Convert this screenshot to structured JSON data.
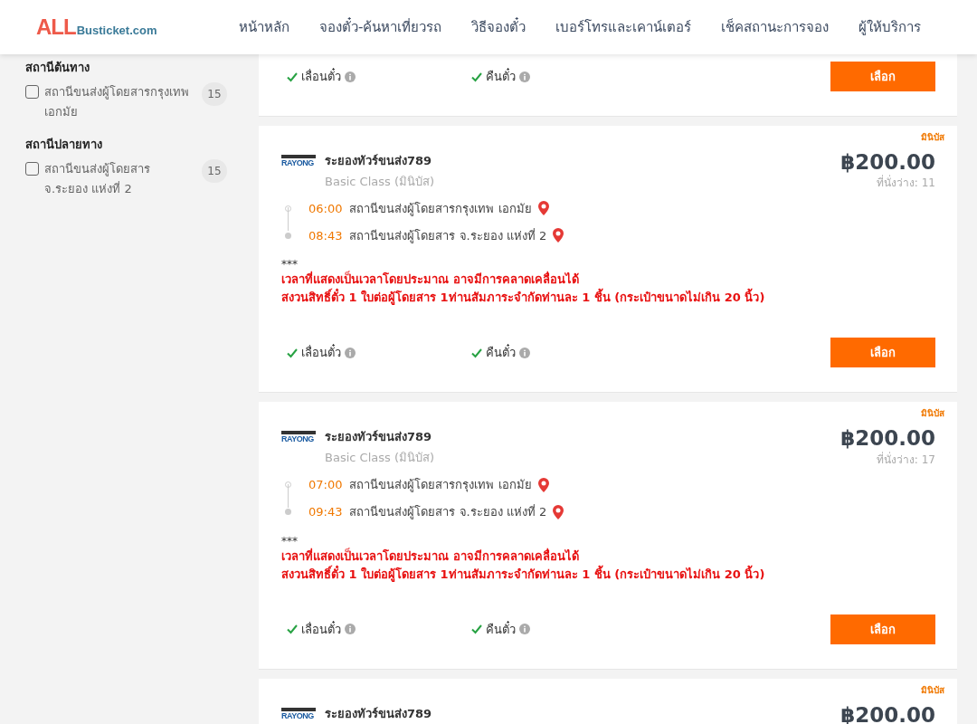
{
  "header": {
    "logo": {
      "accent": "ALL",
      "rest": "Busticket.com"
    },
    "nav": [
      {
        "label": "หน้าหลัก",
        "selected": false
      },
      {
        "label": "จองตั๋ว-ค้นหาเที่ยวรถ",
        "selected": false
      },
      {
        "label": "วิธีจองตั๋ว",
        "selected": false
      },
      {
        "label": "เบอร์โทรและเคาน์เตอร์",
        "selected": false
      },
      {
        "label": "เช็คสถานะการจอง",
        "selected": false
      },
      {
        "label": "ผู้ให้บริการ",
        "selected": false
      }
    ]
  },
  "sidebar": {
    "filters": [
      {
        "title": "สถานีต้นทาง",
        "items": [
          {
            "label": "สถานีขนส่งผู้โดยสารกรุงเทพ เอกมัย",
            "count": "15",
            "checked": false
          }
        ]
      },
      {
        "title": "สถานีปลายทาง",
        "items": [
          {
            "label": "สถานีขนส่งผู้โดยสาร จ.ระยอง แห่งที่ 2",
            "count": "15",
            "checked": false
          }
        ]
      }
    ]
  },
  "trips": [
    {
      "features": [
        {
          "label": "เลื่อนตั๋ว",
          "ok": true
        },
        {
          "label": "คืนตั๋ว",
          "ok": true
        }
      ],
      "button": "เลือก"
    },
    {
      "tag": "มินิบัส",
      "logo_text": "RAYONG",
      "operator": "ระยองทัวร์ขนส่ง789",
      "class": "Basic Class (มินิบัส)",
      "price": "฿200.00",
      "seats": "ที่นั่งว่าง: 11",
      "stops": [
        {
          "time": "06:00",
          "station": "สถานีขนส่งผู้โดยสารกรุงเทพ เอกมัย"
        },
        {
          "time": "08:43",
          "station": "สถานีขนส่งผู้โดยสาร จ.ระยอง แห่งที่ 2"
        }
      ],
      "note": "***",
      "warnings": [
        "เวลาที่แสดงเป็นเวลาโดยประมาณ อาจมีการคลาดเคลื่อนได้",
        "สงวนสิทธิ์ตั๋ว 1 ใบต่อผู้โดยสาร 1ท่านสัมภาระจำกัดท่านละ 1 ชิ้น (กระเป๋าขนาดไม่เกิน 20 นิ้ว)"
      ],
      "features": [
        {
          "label": "เลื่อนตั๋ว",
          "ok": true
        },
        {
          "label": "คืนตั๋ว",
          "ok": true
        }
      ],
      "button": "เลือก"
    },
    {
      "tag": "มินิบัส",
      "logo_text": "RAYONG",
      "operator": "ระยองทัวร์ขนส่ง789",
      "class": "Basic Class (มินิบัส)",
      "price": "฿200.00",
      "seats": "ที่นั่งว่าง: 17",
      "stops": [
        {
          "time": "07:00",
          "station": "สถานีขนส่งผู้โดยสารกรุงเทพ เอกมัย"
        },
        {
          "time": "09:43",
          "station": "สถานีขนส่งผู้โดยสาร จ.ระยอง แห่งที่ 2"
        }
      ],
      "note": "***",
      "warnings": [
        "เวลาที่แสดงเป็นเวลาโดยประมาณ อาจมีการคลาดเคลื่อนได้",
        "สงวนสิทธิ์ตั๋ว 1 ใบต่อผู้โดยสาร 1ท่านสัมภาระจำกัดท่านละ 1 ชิ้น (กระเป๋าขนาดไม่เกิน 20 นิ้ว)"
      ],
      "features": [
        {
          "label": "เลื่อนตั๋ว",
          "ok": true
        },
        {
          "label": "คืนตั๋ว",
          "ok": true
        }
      ],
      "button": "เลือก"
    },
    {
      "tag": "มินิบัส",
      "logo_text": "RAYONG",
      "operator": "ระยองทัวร์ขนส่ง789",
      "price": "฿200.00"
    }
  ]
}
